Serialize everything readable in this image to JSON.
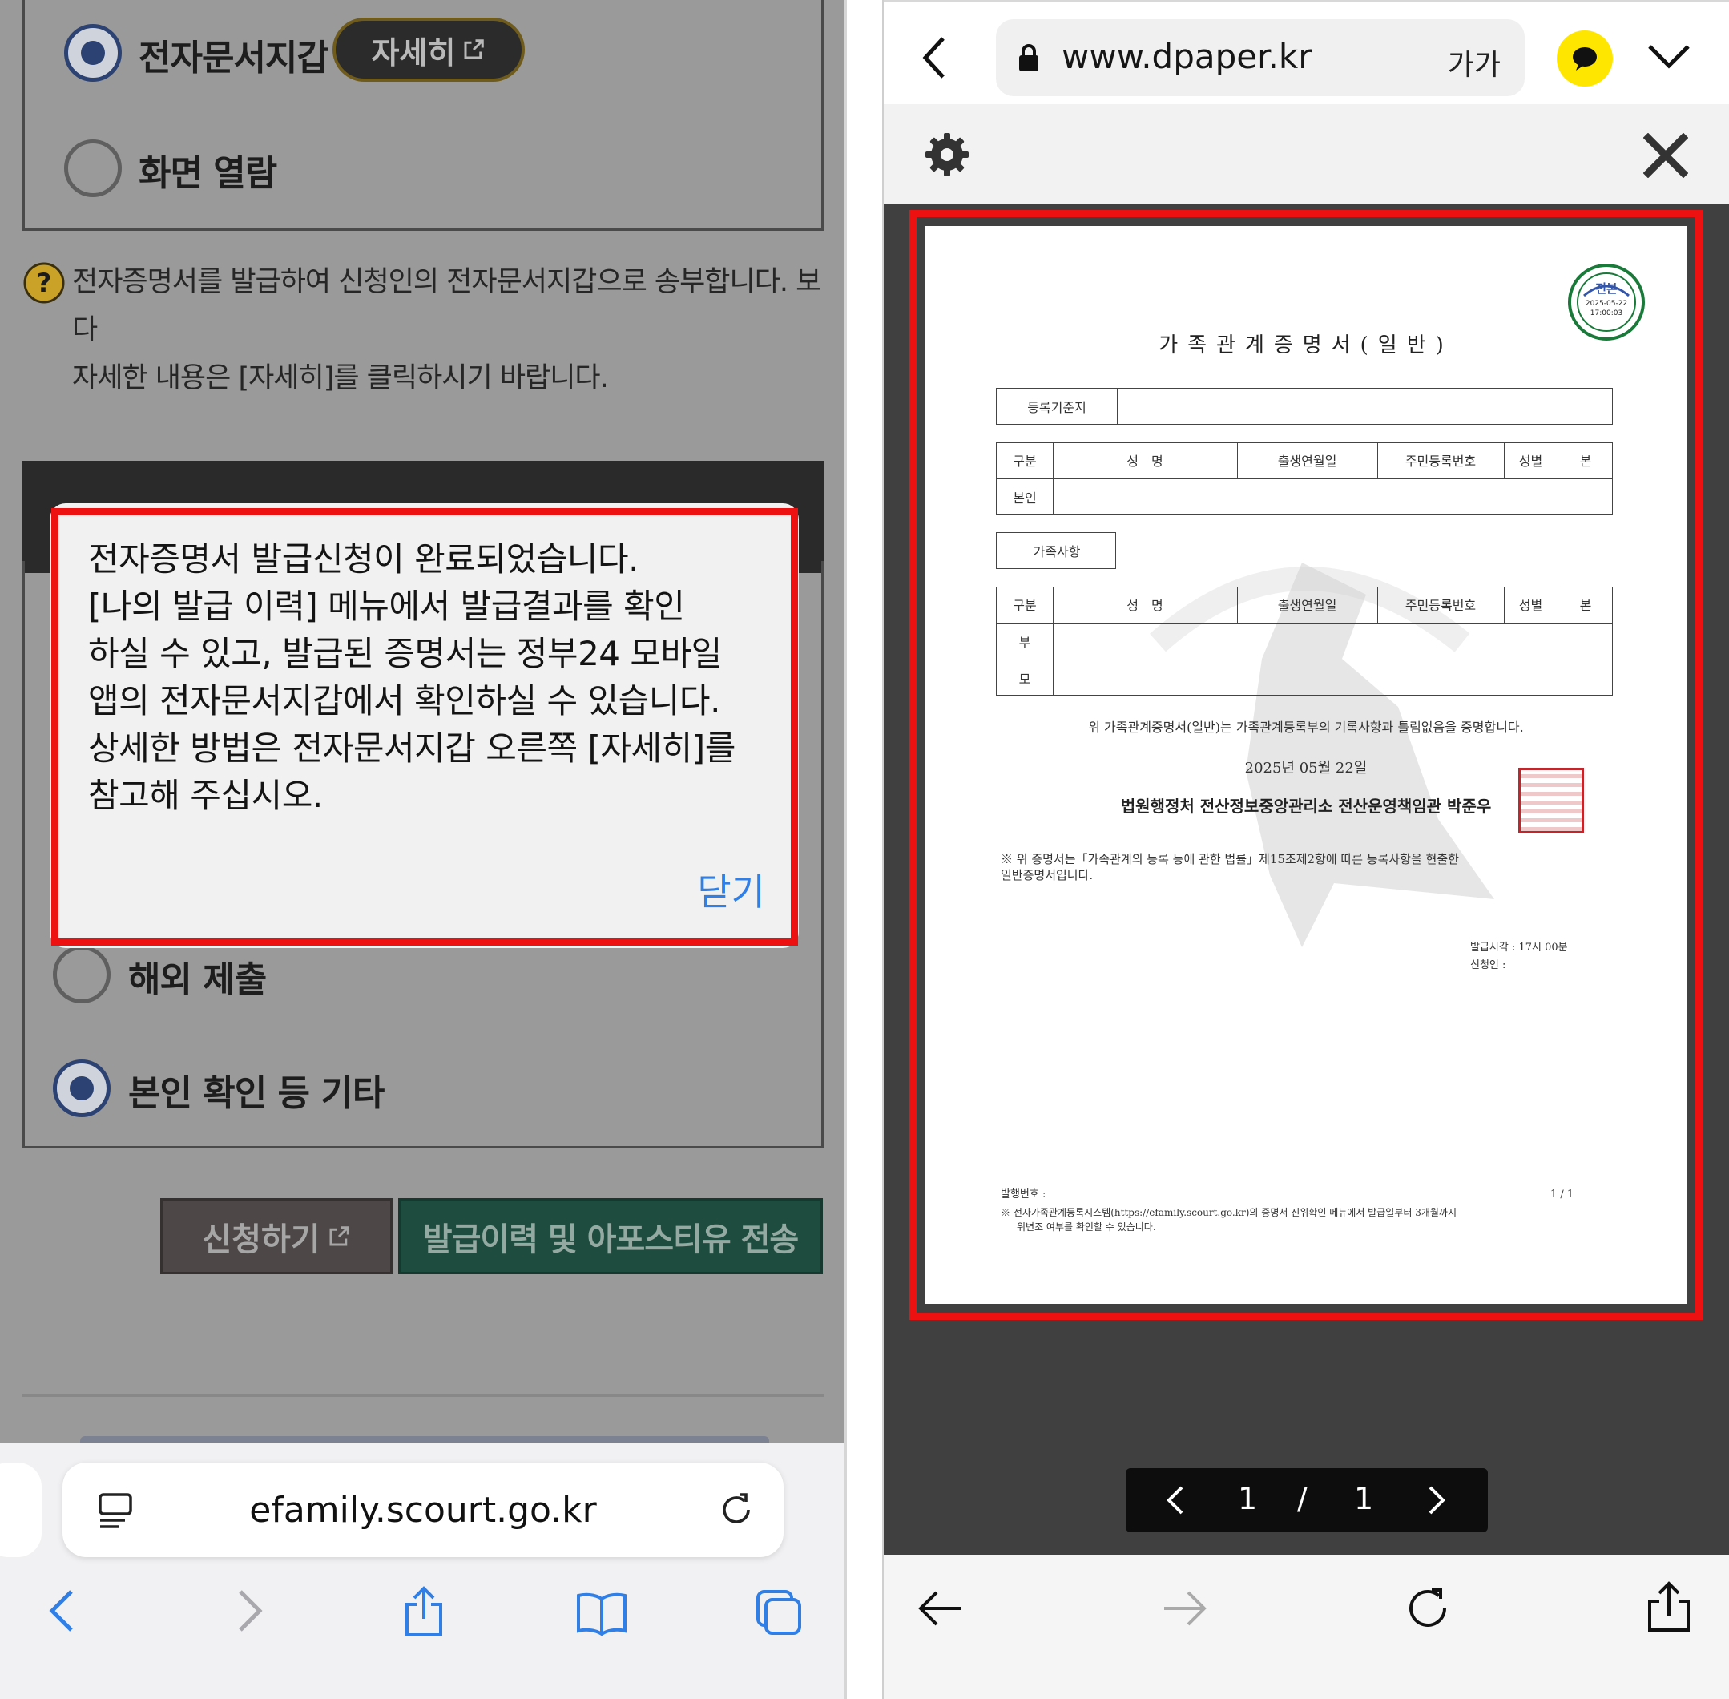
{
  "left_screen": {
    "options": [
      {
        "label": "전자문서지갑",
        "selected": true
      },
      {
        "label": "화면 열람",
        "selected": false
      },
      {
        "label": "해외 제출",
        "selected": false
      },
      {
        "label": "본인 확인 등 기타",
        "selected": true
      }
    ],
    "detail_button": "자세히",
    "help_text_line1": "전자증명서를 발급하여 신청인의 전자문서지갑으로 송부합니다. 보다",
    "help_text_line2": "자세한 내용은 [자세히]를 클릭하시기 바랍니다.",
    "modal": {
      "lines": [
        "전자증명서 발급신청이 완료되었습니다.",
        "[나의 발급 이력] 메뉴에서 발급결과를 확인",
        "하실 수 있고, 발급된 증명서는 정부24 모바일",
        "앱의 전자문서지갑에서 확인하실 수 있습니다.",
        "상세한 방법은 전자문서지갑 오른쪽 [자세히]를",
        "참고해 주십시오."
      ],
      "close_label": "닫기"
    },
    "apply_button": "신청하기",
    "history_button": "발급이력 및 아포스티유 전송",
    "url": "efamily.scourt.go.kr"
  },
  "right_screen": {
    "url": "www.dpaper.kr",
    "font_size_label": "가가",
    "pager": {
      "current": "1",
      "separator": "/",
      "total": "1"
    },
    "document": {
      "title": "가족관계증명서(일반)",
      "stamp_top_text": "진본",
      "stamp_date": "2025-05-22",
      "stamp_time": "17:00:03",
      "reg_base_label": "등록기준지",
      "headers": [
        "구분",
        "성　명",
        "출생연월일",
        "주민등록번호",
        "성별",
        "본"
      ],
      "self_label": "본인",
      "family_label": "가족사항",
      "father_label": "부",
      "mother_label": "모",
      "certify_text": "위 가족관계증명서(일반)는 가족관계등록부의 기록사항과 틀림없음을 증명합니다.",
      "date_text": "2025년 05월 22일",
      "issuer": "법원행정처 전산정보중앙관리소 전산운영책임관 박준우",
      "note_line1": "※ 위 증명서는「가족관계의 등록 등에 관한 법률」제15조제2항에 따른 등록사항을 현출한",
      "note_line2": "일반증명서입니다.",
      "issue_time": "발급시각 : 17시 00분",
      "applicant": "신청인 :",
      "issue_no": "발행번호 :",
      "page_count": "1 / 1",
      "footer_line1": "※ 전자가족관계등록시스템(https://efamily.scourt.go.kr)의 증명서 진위확인 메뉴에서 발급일부터 3개월까지",
      "footer_line2": "위변조 여부를 확인할 수 있습니다."
    }
  },
  "colors": {
    "highlight_red": "#ee1111",
    "modal_link_blue": "#2f7fe6",
    "kakao_yellow": "#ffe600",
    "history_button_green": "#1e4d40"
  },
  "icons": [
    "external-link-icon",
    "help-icon",
    "reader-icon",
    "reload-icon",
    "back-icon",
    "forward-icon",
    "share-icon",
    "bookmarks-icon",
    "tabs-icon",
    "lock-icon",
    "kakao-chat-icon",
    "chevron-down-icon",
    "gear-icon",
    "close-icon"
  ]
}
